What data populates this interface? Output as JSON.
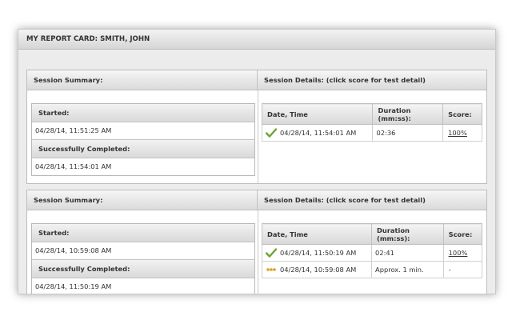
{
  "header": {
    "title": "MY REPORT CARD: SMITH, JOHN"
  },
  "sessions": [
    {
      "summary_title": "Session Summary:",
      "details_title": "Session Details: (click score for test detail)",
      "started_label": "Started:",
      "started_value": "04/28/14, 11:51:25 AM",
      "completed_label": "Successfully Completed:",
      "completed_value": "04/28/14, 11:54:01 AM",
      "columns": [
        "Date, Time",
        "Duration (mm:ss):",
        "Score:"
      ],
      "rows": [
        {
          "status": "check-icon",
          "date": "04/28/14, 11:54:01 AM",
          "duration": "02:36",
          "score": "100%"
        }
      ]
    },
    {
      "summary_title": "Session Summary:",
      "details_title": "Session Details: (click score for test detail)",
      "started_label": "Started:",
      "started_value": "04/28/14, 10:59:08 AM",
      "completed_label": "Successfully Completed:",
      "completed_value": "04/28/14, 11:50:19 AM",
      "columns": [
        "Date, Time",
        "Duration (mm:ss):",
        "Score:"
      ],
      "rows": [
        {
          "status": "check-icon",
          "date": "04/28/14, 11:50:19 AM",
          "duration": "02:41",
          "score": "100%"
        },
        {
          "status": "in-progress-icon",
          "date": "04/28/14, 10:59:08 AM",
          "duration": "Approx. 1 min.",
          "score": "-"
        }
      ]
    }
  ],
  "colors": {
    "check": "#6aa531",
    "in_progress": "#e0a020",
    "frame_bg": "#ececec",
    "header_gradient_top": "#f3f3f3",
    "header_gradient_bottom": "#d6d6d6"
  }
}
